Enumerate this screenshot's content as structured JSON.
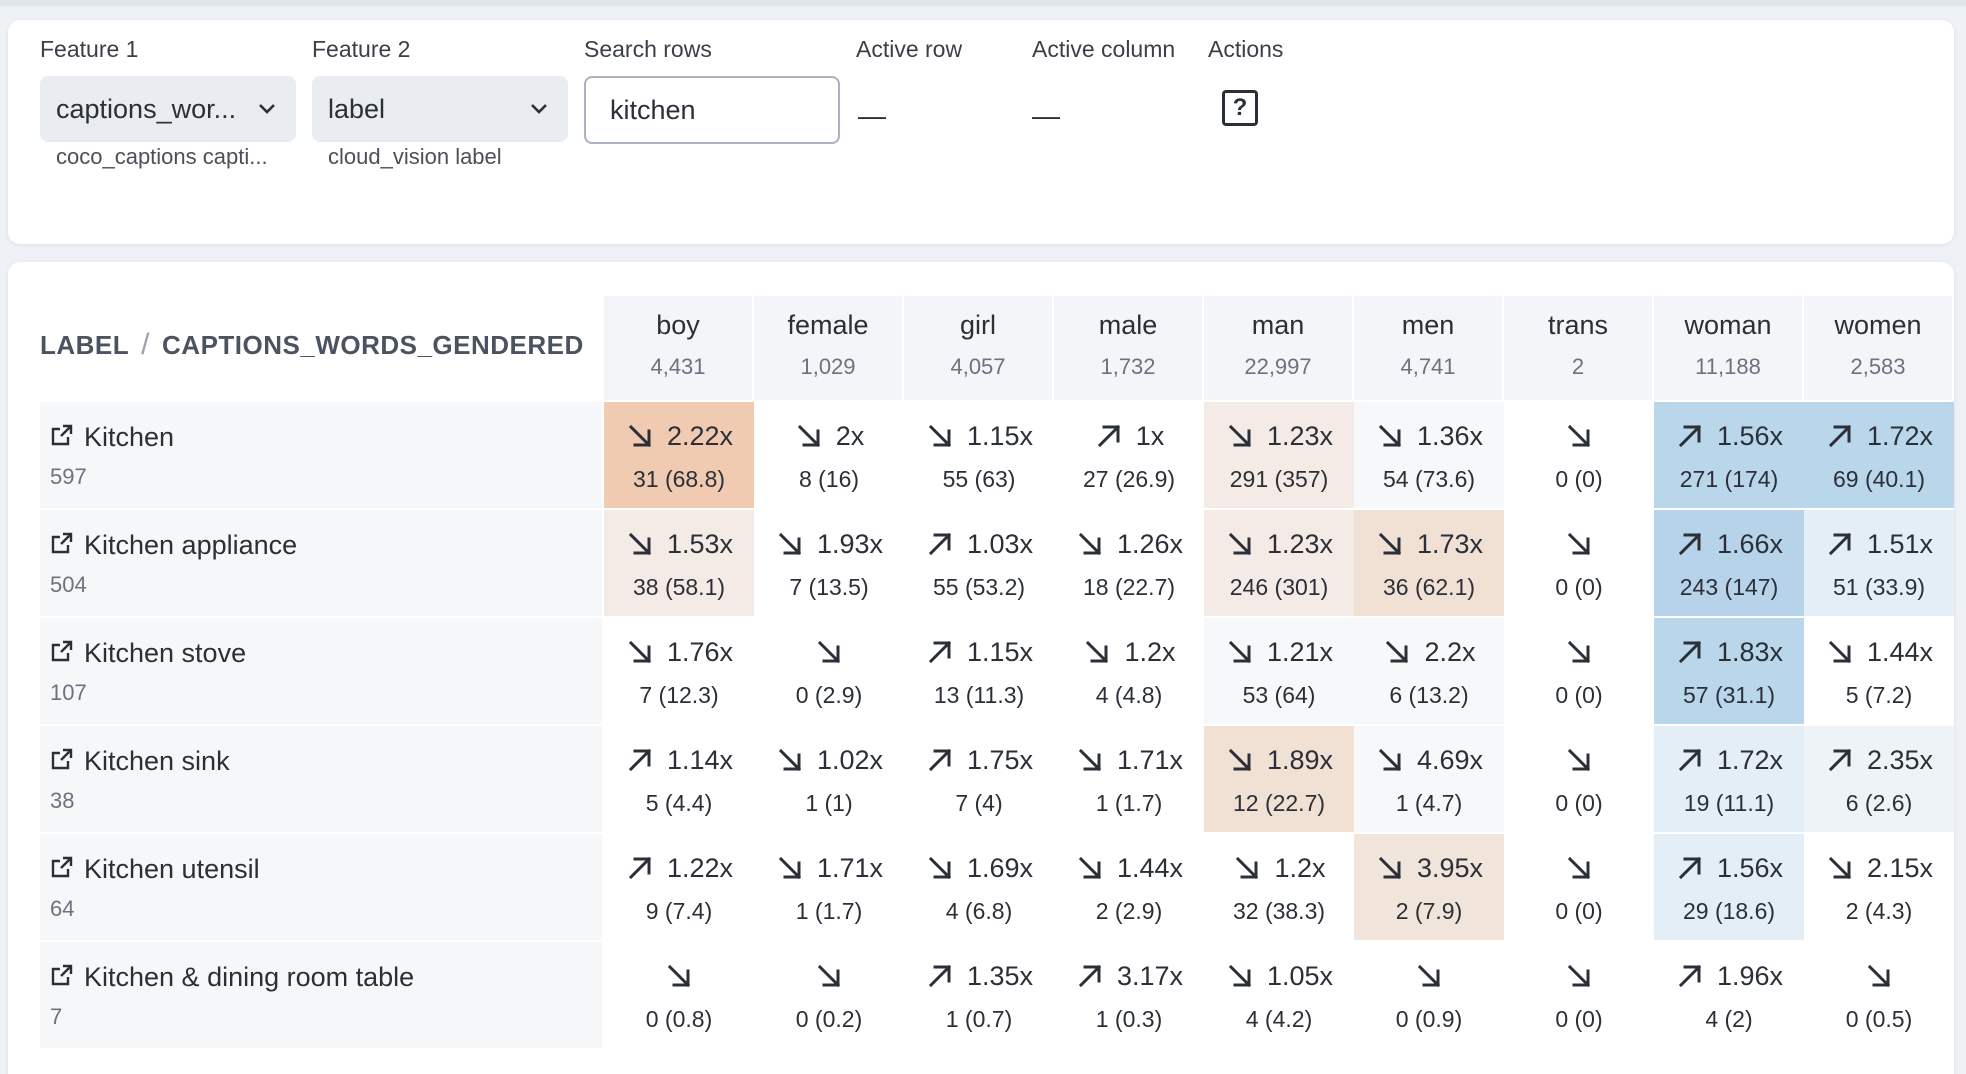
{
  "controls": {
    "feature1": {
      "label": "Feature 1",
      "value": "captions_wor...",
      "sub": "coco_captions capti..."
    },
    "feature2": {
      "label": "Feature 2",
      "value": "label",
      "sub": "cloud_vision label"
    },
    "search": {
      "label": "Search rows",
      "value": "kitchen",
      "placeholder": ""
    },
    "active_row": {
      "label": "Active row",
      "value": "—"
    },
    "active_column": {
      "label": "Active column",
      "value": "—"
    },
    "actions": {
      "label": "Actions",
      "help_icon": "?"
    }
  },
  "matrix": {
    "title_left": "LABEL",
    "title_sep": "/",
    "title_right": "CAPTIONS_WORDS_GENDERED",
    "columns": [
      {
        "name": "boy",
        "count": "4,431"
      },
      {
        "name": "female",
        "count": "1,029"
      },
      {
        "name": "girl",
        "count": "4,057"
      },
      {
        "name": "male",
        "count": "1,732"
      },
      {
        "name": "man",
        "count": "22,997"
      },
      {
        "name": "men",
        "count": "4,741"
      },
      {
        "name": "trans",
        "count": "2"
      },
      {
        "name": "woman",
        "count": "11,188"
      },
      {
        "name": "women",
        "count": "2,583"
      }
    ],
    "rows": [
      {
        "name": "Kitchen",
        "count": "597",
        "cells": [
          {
            "dir": "down",
            "ratio": "2.22x",
            "counts": "31 (68.8)",
            "bg": "#f0cbb2"
          },
          {
            "dir": "down",
            "ratio": "2x",
            "counts": "8 (16)",
            "bg": "#ffffff"
          },
          {
            "dir": "down",
            "ratio": "1.15x",
            "counts": "55 (63)",
            "bg": "#ffffff"
          },
          {
            "dir": "up",
            "ratio": "1x",
            "counts": "27 (26.9)",
            "bg": "#ffffff"
          },
          {
            "dir": "down",
            "ratio": "1.23x",
            "counts": "291 (357)",
            "bg": "#f5ebe6"
          },
          {
            "dir": "down",
            "ratio": "1.36x",
            "counts": "54 (73.6)",
            "bg": "#f7f8fa"
          },
          {
            "dir": "down",
            "ratio": "",
            "counts": "0 (0)",
            "bg": "#ffffff"
          },
          {
            "dir": "up",
            "ratio": "1.56x",
            "counts": "271 (174)",
            "bg": "#b9d6ea"
          },
          {
            "dir": "up",
            "ratio": "1.72x",
            "counts": "69 (40.1)",
            "bg": "#b9d6ea"
          }
        ]
      },
      {
        "name": "Kitchen appliance",
        "count": "504",
        "cells": [
          {
            "dir": "down",
            "ratio": "1.53x",
            "counts": "38 (58.1)",
            "bg": "#f5ebe6"
          },
          {
            "dir": "down",
            "ratio": "1.93x",
            "counts": "7 (13.5)",
            "bg": "#ffffff"
          },
          {
            "dir": "up",
            "ratio": "1.03x",
            "counts": "55 (53.2)",
            "bg": "#ffffff"
          },
          {
            "dir": "down",
            "ratio": "1.26x",
            "counts": "18 (22.7)",
            "bg": "#ffffff"
          },
          {
            "dir": "down",
            "ratio": "1.23x",
            "counts": "246 (301)",
            "bg": "#f5ebe6"
          },
          {
            "dir": "down",
            "ratio": "1.73x",
            "counts": "36 (62.1)",
            "bg": "#f1e0d4"
          },
          {
            "dir": "down",
            "ratio": "",
            "counts": "0 (0)",
            "bg": "#ffffff"
          },
          {
            "dir": "up",
            "ratio": "1.66x",
            "counts": "243 (147)",
            "bg": "#b6d3ea"
          },
          {
            "dir": "up",
            "ratio": "1.51x",
            "counts": "51 (33.9)",
            "bg": "#e4eef6"
          }
        ]
      },
      {
        "name": "Kitchen stove",
        "count": "107",
        "cells": [
          {
            "dir": "down",
            "ratio": "1.76x",
            "counts": "7 (12.3)",
            "bg": "#ffffff"
          },
          {
            "dir": "down",
            "ratio": "",
            "counts": "0 (2.9)",
            "bg": "#ffffff"
          },
          {
            "dir": "up",
            "ratio": "1.15x",
            "counts": "13 (11.3)",
            "bg": "#ffffff"
          },
          {
            "dir": "down",
            "ratio": "1.2x",
            "counts": "4 (4.8)",
            "bg": "#ffffff"
          },
          {
            "dir": "down",
            "ratio": "1.21x",
            "counts": "53 (64)",
            "bg": "#f7f8fa"
          },
          {
            "dir": "down",
            "ratio": "2.2x",
            "counts": "6 (13.2)",
            "bg": "#f7f8fa"
          },
          {
            "dir": "down",
            "ratio": "",
            "counts": "0 (0)",
            "bg": "#ffffff"
          },
          {
            "dir": "up",
            "ratio": "1.83x",
            "counts": "57 (31.1)",
            "bg": "#b9d6ea"
          },
          {
            "dir": "down",
            "ratio": "1.44x",
            "counts": "5 (7.2)",
            "bg": "#ffffff"
          }
        ]
      },
      {
        "name": "Kitchen sink",
        "count": "38",
        "cells": [
          {
            "dir": "up",
            "ratio": "1.14x",
            "counts": "5 (4.4)",
            "bg": "#ffffff"
          },
          {
            "dir": "down",
            "ratio": "1.02x",
            "counts": "1 (1)",
            "bg": "#ffffff"
          },
          {
            "dir": "up",
            "ratio": "1.75x",
            "counts": "7 (4)",
            "bg": "#ffffff"
          },
          {
            "dir": "down",
            "ratio": "1.71x",
            "counts": "1 (1.7)",
            "bg": "#ffffff"
          },
          {
            "dir": "down",
            "ratio": "1.89x",
            "counts": "12 (22.7)",
            "bg": "#f1e0d4"
          },
          {
            "dir": "down",
            "ratio": "4.69x",
            "counts": "1 (4.7)",
            "bg": "#f7f8fa"
          },
          {
            "dir": "down",
            "ratio": "",
            "counts": "0 (0)",
            "bg": "#ffffff"
          },
          {
            "dir": "up",
            "ratio": "1.72x",
            "counts": "19 (11.1)",
            "bg": "#e4eef6"
          },
          {
            "dir": "up",
            "ratio": "2.35x",
            "counts": "6 (2.6)",
            "bg": "#eef3f8"
          }
        ]
      },
      {
        "name": "Kitchen utensil",
        "count": "64",
        "cells": [
          {
            "dir": "up",
            "ratio": "1.22x",
            "counts": "9 (7.4)",
            "bg": "#ffffff"
          },
          {
            "dir": "down",
            "ratio": "1.71x",
            "counts": "1 (1.7)",
            "bg": "#ffffff"
          },
          {
            "dir": "down",
            "ratio": "1.69x",
            "counts": "4 (6.8)",
            "bg": "#ffffff"
          },
          {
            "dir": "down",
            "ratio": "1.44x",
            "counts": "2 (2.9)",
            "bg": "#ffffff"
          },
          {
            "dir": "down",
            "ratio": "1.2x",
            "counts": "32 (38.3)",
            "bg": "#ffffff"
          },
          {
            "dir": "down",
            "ratio": "3.95x",
            "counts": "2 (7.9)",
            "bg": "#f1e4da"
          },
          {
            "dir": "down",
            "ratio": "",
            "counts": "0 (0)",
            "bg": "#ffffff"
          },
          {
            "dir": "up",
            "ratio": "1.56x",
            "counts": "29 (18.6)",
            "bg": "#e4eef6"
          },
          {
            "dir": "down",
            "ratio": "2.15x",
            "counts": "2 (4.3)",
            "bg": "#ffffff"
          }
        ]
      },
      {
        "name": "Kitchen & dining room table",
        "count": "7",
        "cells": [
          {
            "dir": "down",
            "ratio": "",
            "counts": "0 (0.8)",
            "bg": "#ffffff"
          },
          {
            "dir": "down",
            "ratio": "",
            "counts": "0 (0.2)",
            "bg": "#ffffff"
          },
          {
            "dir": "up",
            "ratio": "1.35x",
            "counts": "1 (0.7)",
            "bg": "#ffffff"
          },
          {
            "dir": "up",
            "ratio": "3.17x",
            "counts": "1 (0.3)",
            "bg": "#ffffff"
          },
          {
            "dir": "down",
            "ratio": "1.05x",
            "counts": "4 (4.2)",
            "bg": "#ffffff"
          },
          {
            "dir": "down",
            "ratio": "",
            "counts": "0 (0.9)",
            "bg": "#ffffff"
          },
          {
            "dir": "down",
            "ratio": "",
            "counts": "0 (0)",
            "bg": "#ffffff"
          },
          {
            "dir": "up",
            "ratio": "1.96x",
            "counts": "4 (2)",
            "bg": "#ffffff"
          },
          {
            "dir": "down",
            "ratio": "",
            "counts": "0 (0.5)",
            "bg": "#ffffff"
          }
        ]
      }
    ]
  }
}
